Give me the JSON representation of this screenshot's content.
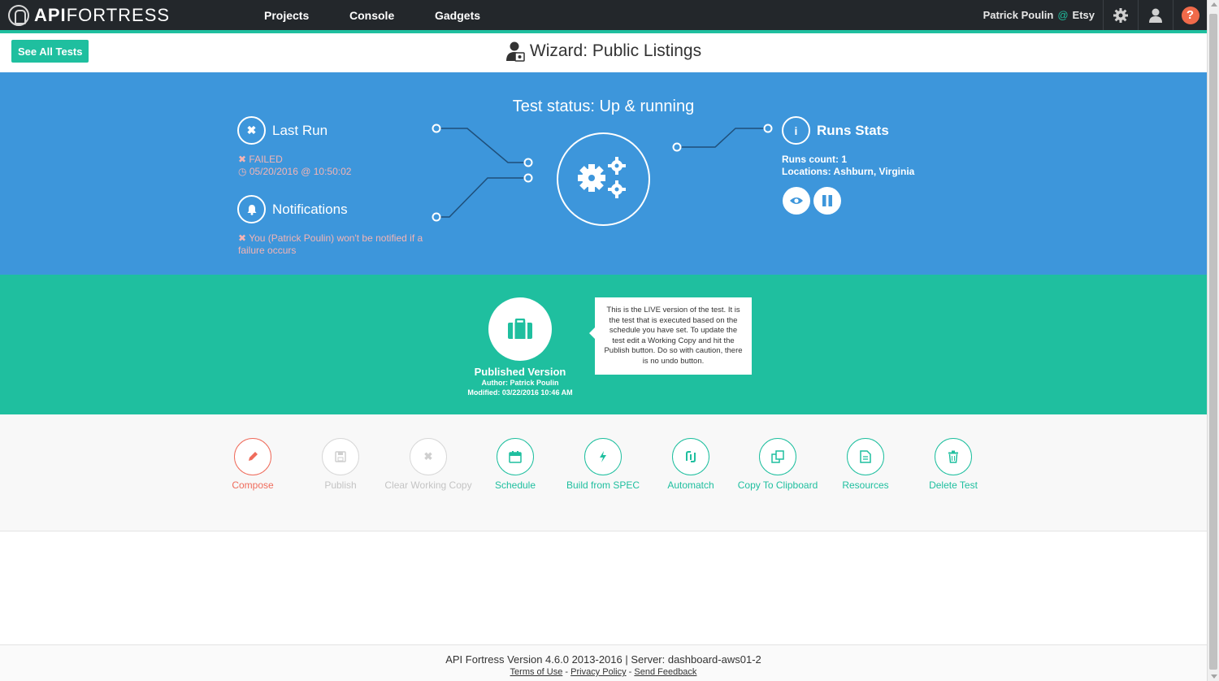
{
  "topbar": {
    "logo_bold": "API",
    "logo_light": "FORTRESS",
    "nav": [
      "Projects",
      "Console",
      "Gadgets"
    ],
    "user_name": "Patrick Poulin",
    "user_at": "@",
    "org": "Etsy",
    "help_glyph": "?"
  },
  "header": {
    "see_all_label": "See All Tests",
    "title": "Wizard: Public Listings"
  },
  "status": {
    "text": "Test status: Up & running",
    "last_run_title": "Last Run",
    "last_run_result": "FAILED",
    "last_run_date": "05/20/2016 @ 10:50:02",
    "notifications_title": "Notifications",
    "notifications_text": "You (Patrick Poulin) won't be notified if a failure occurs",
    "runs_title": "Runs Stats",
    "runs_count": "Runs count: 1",
    "locations": "Locations: Ashburn, Virginia"
  },
  "published": {
    "title": "Published Version",
    "author": "Author: Patrick Poulin",
    "modified": "Modified: 03/22/2016 10:46 AM",
    "tooltip": "This is the LIVE version of the test. It is the test that is executed based on the schedule you have set. To update the test edit a Working Copy and hit the Publish button. Do so with caution, there is no undo button."
  },
  "actions": {
    "compose": "Compose",
    "publish": "Publish",
    "clear_working_copy": "Clear Working Copy",
    "schedule": "Schedule",
    "build_from_spec": "Build from SPEC",
    "automatch": "Automatch",
    "copy_to_clipboard": "Copy To Clipboard",
    "resources": "Resources",
    "delete_test": "Delete Test"
  },
  "footer": {
    "version": "API Fortress Version 4.6.0 2013-2016 | Server: dashboard-aws01-2",
    "terms": "Terms of Use",
    "privacy": "Privacy Policy",
    "feedback": "Send Feedback",
    "sep": " - "
  },
  "colors": {
    "topbar": "#23272b",
    "accent": "#1fbf9f",
    "blue_panel": "#3d96db",
    "compose": "#ef6c5c",
    "help": "#f06a4a"
  },
  "icons": {
    "last_run": "times-icon",
    "notifications": "bell-icon",
    "runs_stats": "info-icon",
    "status": "gears-icon",
    "view": "eye-icon",
    "pause": "pause-icon",
    "published": "briefcase-icon"
  }
}
